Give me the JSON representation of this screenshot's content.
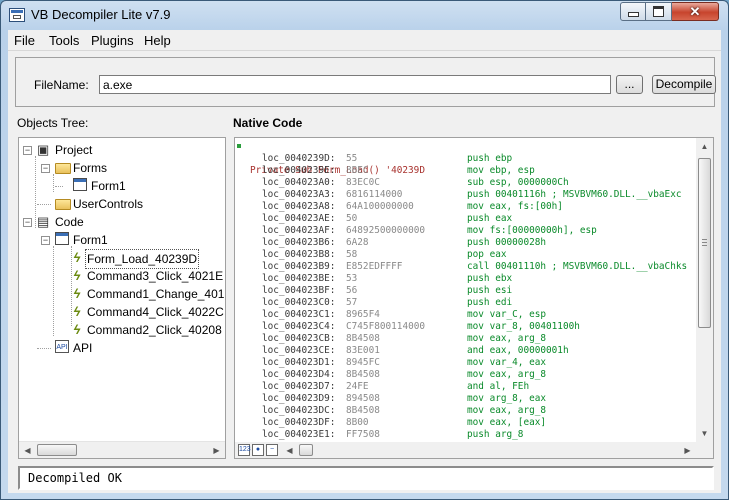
{
  "window": {
    "title": "VB Decompiler Lite v7.9",
    "close_glyph": "✕"
  },
  "menu": [
    "File",
    "Tools",
    "Plugins",
    "Help"
  ],
  "file": {
    "label": "FileName:",
    "value": "a.exe",
    "browse_label": "...",
    "decompile_label": "Decompile"
  },
  "panels": {
    "objects_tree": "Objects Tree:",
    "native_code": "Native Code"
  },
  "tree": {
    "project": "Project",
    "forms": "Forms",
    "form1": "Form1",
    "user_controls": "UserControls",
    "code": "Code",
    "code_form1": "Form1",
    "procs": [
      "Form_Load_40239D",
      "Command3_Click_4021E",
      "Command1_Change_401",
      "Command4_Click_4022C",
      "Command2_Click_40208"
    ],
    "api": "API"
  },
  "code": {
    "header": "Private Sub Form_Load() '40239D",
    "lines": [
      {
        "addr": "loc_0040239D:",
        "bytes": "55",
        "asm": "push ebp"
      },
      {
        "addr": "loc_0040239E:",
        "bytes": "8BEC",
        "asm": "mov ebp, esp"
      },
      {
        "addr": "loc_004023A0:",
        "bytes": "83EC0C",
        "asm": "sub esp, 0000000Ch"
      },
      {
        "addr": "loc_004023A3:",
        "bytes": "6816114000",
        "asm": "push 00401116h ; MSVBVM60.DLL.__vbaExc"
      },
      {
        "addr": "loc_004023A8:",
        "bytes": "64A100000000",
        "asm": "mov eax, fs:[00h]"
      },
      {
        "addr": "loc_004023AE:",
        "bytes": "50",
        "asm": "push eax"
      },
      {
        "addr": "loc_004023AF:",
        "bytes": "64892500000000",
        "asm": "mov fs:[00000000h], esp"
      },
      {
        "addr": "loc_004023B6:",
        "bytes": "6A28",
        "asm": "push 00000028h"
      },
      {
        "addr": "loc_004023B8:",
        "bytes": "58",
        "asm": "pop eax"
      },
      {
        "addr": "loc_004023B9:",
        "bytes": "E852EDFFFF",
        "asm": "call 00401110h ; MSVBVM60.DLL.__vbaChks"
      },
      {
        "addr": "loc_004023BE:",
        "bytes": "53",
        "asm": "push ebx"
      },
      {
        "addr": "loc_004023BF:",
        "bytes": "56",
        "asm": "push esi"
      },
      {
        "addr": "loc_004023C0:",
        "bytes": "57",
        "asm": "push edi"
      },
      {
        "addr": "loc_004023C1:",
        "bytes": "8965F4",
        "asm": "mov var_C, esp"
      },
      {
        "addr": "loc_004023C4:",
        "bytes": "C745F800114000",
        "asm": "mov var_8, 00401100h"
      },
      {
        "addr": "loc_004023CB:",
        "bytes": "8B4508",
        "asm": "mov eax, arg_8"
      },
      {
        "addr": "loc_004023CE:",
        "bytes": "83E001",
        "asm": "and eax, 00000001h"
      },
      {
        "addr": "loc_004023D1:",
        "bytes": "8945FC",
        "asm": "mov var_4, eax"
      },
      {
        "addr": "loc_004023D4:",
        "bytes": "8B4508",
        "asm": "mov eax, arg_8"
      },
      {
        "addr": "loc_004023D7:",
        "bytes": "24FE",
        "asm": "and al, FEh"
      },
      {
        "addr": "loc_004023D9:",
        "bytes": "894508",
        "asm": "mov arg_8, eax"
      },
      {
        "addr": "loc_004023DC:",
        "bytes": "8B4508",
        "asm": "mov eax, arg_8"
      },
      {
        "addr": "loc_004023DF:",
        "bytes": "8B00",
        "asm": "mov eax, [eax]"
      },
      {
        "addr": "loc_004023E1:",
        "bytes": "FF7508",
        "asm": "push arg_8"
      }
    ]
  },
  "status": "Decompiled OK",
  "colors": {
    "asm": "#0a8a2a",
    "header": "#a8322e",
    "bytes": "#8a8a8a"
  },
  "icons": {
    "tree_leaf_proc": "lightning-icon",
    "mini_buttons": [
      "hex-view-icon",
      "code-view-icon",
      "collapse-icon"
    ]
  }
}
